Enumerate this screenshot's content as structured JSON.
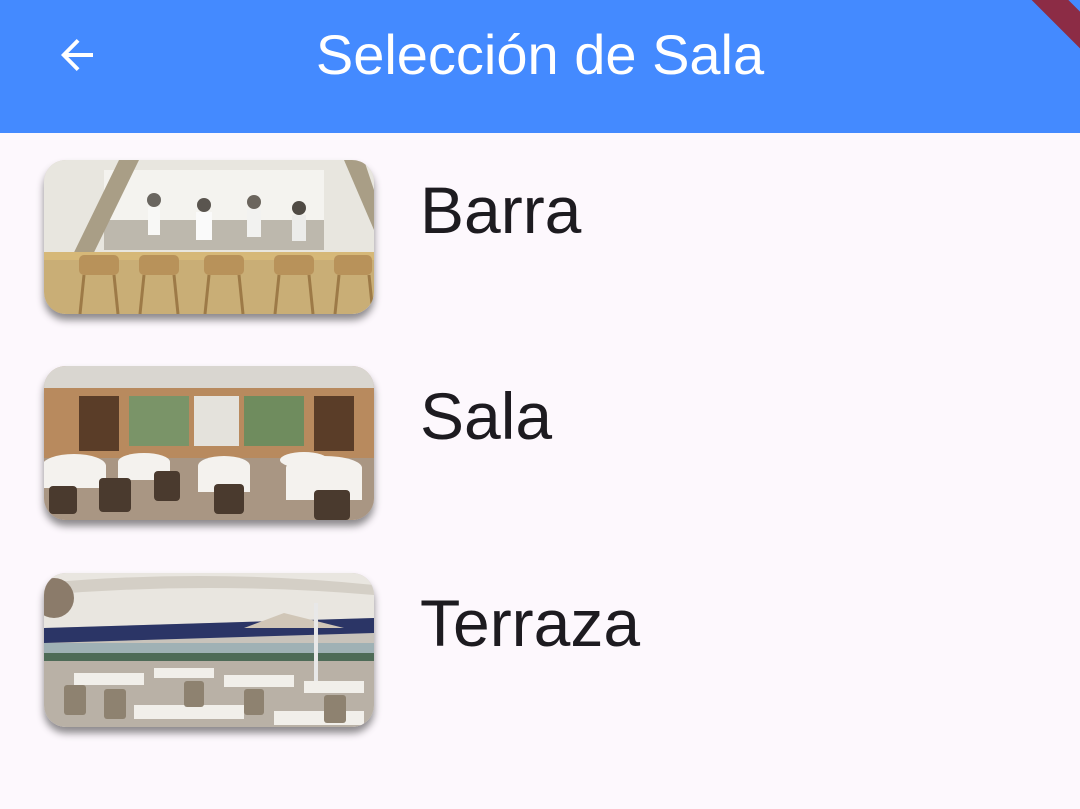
{
  "appbar": {
    "title": "Selección de Sala",
    "back_icon": "arrow-left-icon",
    "color": "#448aff"
  },
  "rooms": [
    {
      "label": "Barra",
      "image": "bar-counter-photo"
    },
    {
      "label": "Sala",
      "image": "dining-room-photo"
    },
    {
      "label": "Terraza",
      "image": "terrace-photo"
    }
  ],
  "colors": {
    "background": "#fdf8fd",
    "text": "#1d1b20"
  }
}
